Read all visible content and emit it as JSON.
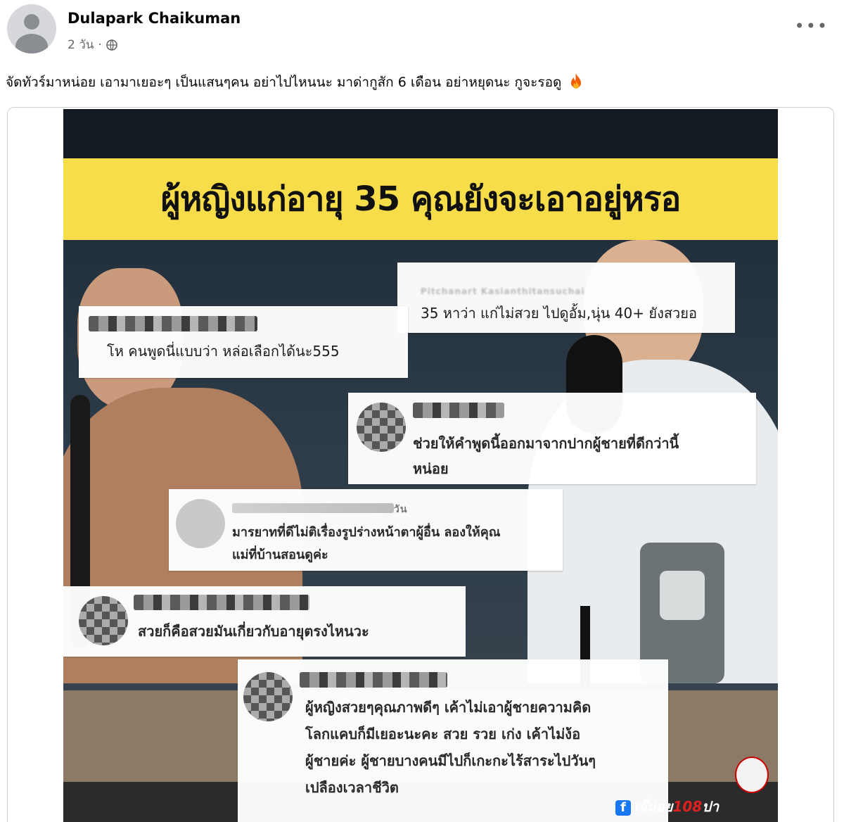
{
  "post": {
    "author": "Dulapark Chaikuman",
    "time": "2 วัน",
    "separator": "·",
    "privacy_icon": "globe-icon",
    "more_icon": "•••",
    "caption": "จัดทัวร์มาหน่อย เอามาเยอะๆ เป็นแสนๆคน อย่าไปไหนนะ มาด่ากูสัก 6 เดือน อย่าหยุดนะ กูจะรอดู",
    "caption_emoji": "fire-icon"
  },
  "image": {
    "banner_title": "ผู้หญิงแก่อายุ 35 คุณยังจะเอาอยู่หรอ",
    "banner_color": "#f7dd4a",
    "comments": [
      {
        "id": "c1",
        "name": "Pitchanart Kasianthitansuchai",
        "text": "35 หาว่า แก่ไม่สวย ไปดูอั้ม,นุ่น 40+ ยังสวยอ"
      },
      {
        "id": "c2",
        "text": "โห คนพูดนี่แบบว่า หล่อเลือกได้นะ555"
      },
      {
        "id": "c3",
        "text_lines": [
          "ช่วยให้คำพูดนี้ออกมาจากปากผู้ชายที่ดีกว่านี้",
          "หน่อย"
        ]
      },
      {
        "id": "c4",
        "name_suffix": "วัน",
        "text_lines": [
          "มารยาทที่ดีไม่ติเรื่องรูปร่างหน้าตาผู้อื่น ลองให้คุณ",
          "แม่ที่บ้านสอนดูค่ะ"
        ]
      },
      {
        "id": "c5",
        "text": "สวยก็คือสวยมันเกี่ยวกับอายุตรงไหนวะ"
      },
      {
        "id": "c6",
        "text_lines": [
          "ผู้หญิงสวยๆคุณภาพดีๆ เค้าไม่เอาผู้ชายความคิด",
          "โลกแคบก็มีเยอะนะคะ สวย รวย เก่ง เค้าไม่ง้อ",
          "ผู้ชายค่ะ ผู้ชายบางคนมีไปก็เกะกะไร้สาระไปวันๆ",
          "เปลืองเวลาชีวิต"
        ]
      }
    ],
    "watermark": {
      "prefix": "เจ๊มอย",
      "number": "108",
      "suffix": "ปา"
    }
  }
}
